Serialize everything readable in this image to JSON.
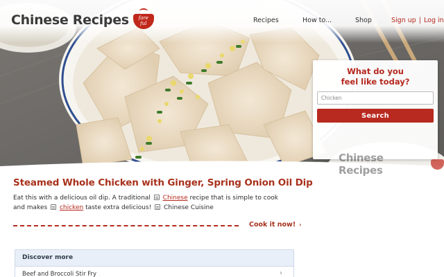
{
  "header": {
    "logo_text": "Chinese Recipes",
    "logo_badge_text": "fare ful",
    "nav": {
      "recipes": "Recipes",
      "howto": "How to...",
      "shop": "Shop"
    },
    "auth": {
      "signup": "Sign up",
      "separator": "|",
      "login": "Log in"
    }
  },
  "search": {
    "title_line1": "What do you",
    "title_line2": "feel like today?",
    "placeholder": "Chicken",
    "button_label": "Search"
  },
  "watermark": {
    "text": "Chinese Recipes"
  },
  "article": {
    "title": "Steamed Whole Chicken with Ginger, Spring Onion Oil Dip",
    "desc_part1": "Eat this with a delicious oil dip. A traditional",
    "desc_link1": "Chinese",
    "desc_part2": "recipe that is simple to cook and makes",
    "desc_link2": "chicken",
    "desc_part3": "taste extra delicious!",
    "cuisine_tag": "Chinese Cuisine",
    "cook_now": "Cook it now!",
    "cook_arrow": "›"
  },
  "discover": {
    "title": "Discover more",
    "items": [
      {
        "label": "Beef and Broccoli Stir Fry"
      }
    ]
  },
  "colors": {
    "brand_red": "#b5281e",
    "title_red": "#a8321c",
    "discover_head_bg": "#e9eff8"
  }
}
